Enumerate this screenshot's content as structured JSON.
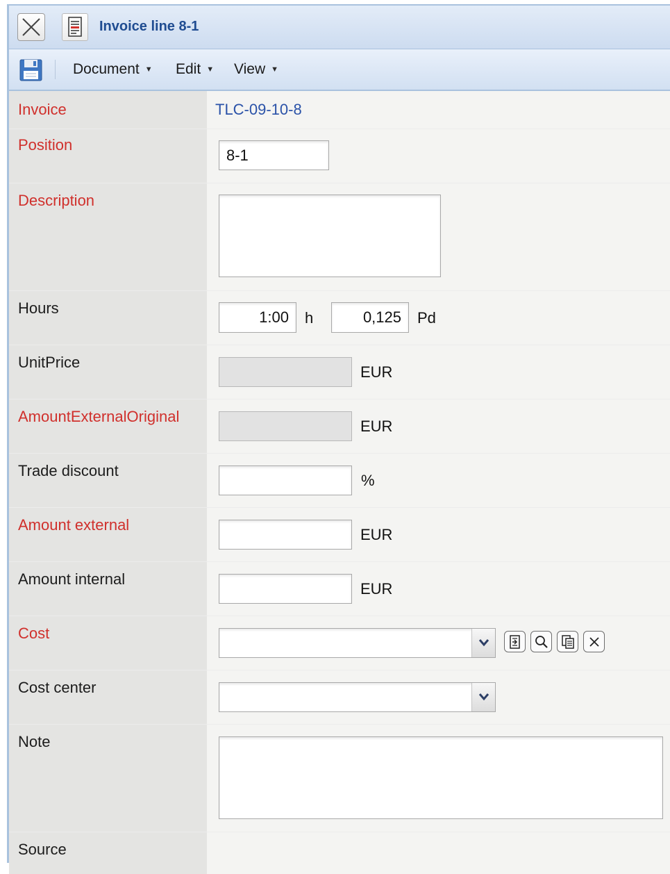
{
  "window": {
    "title": "Invoice line 8-1"
  },
  "toolbar": {
    "menus": [
      {
        "label": "Document"
      },
      {
        "label": "Edit"
      },
      {
        "label": "View"
      }
    ]
  },
  "form": {
    "invoice": {
      "label": "Invoice",
      "value": "TLC-09-10-8"
    },
    "position": {
      "label": "Position",
      "value": "8-1"
    },
    "description": {
      "label": "Description",
      "value": ""
    },
    "hours": {
      "label": "Hours",
      "value": "1:00",
      "unit": "h",
      "pd_value": "0,125",
      "pd_unit": "Pd"
    },
    "unit_price": {
      "label": "UnitPrice",
      "value": "",
      "unit": "EUR"
    },
    "amount_external_original": {
      "label": "AmountExternalOriginal",
      "value": "",
      "unit": "EUR"
    },
    "trade_discount": {
      "label": "Trade discount",
      "value": "",
      "unit": "%"
    },
    "amount_external": {
      "label": "Amount external",
      "value": "",
      "unit": "EUR"
    },
    "amount_internal": {
      "label": "Amount internal",
      "value": "",
      "unit": "EUR"
    },
    "cost": {
      "label": "Cost",
      "value": ""
    },
    "cost_center": {
      "label": "Cost center",
      "value": ""
    },
    "note": {
      "label": "Note",
      "value": ""
    },
    "source": {
      "label": "Source"
    }
  },
  "icons": {
    "close": "close-icon",
    "document": "document-icon",
    "save": "floppy-disk-icon",
    "cost_actions": [
      "open-icon",
      "search-icon",
      "copy-icon",
      "clear-icon"
    ]
  },
  "colors": {
    "required_label": "#d0302c",
    "link": "#2a52a8",
    "title": "#1f4c91"
  }
}
